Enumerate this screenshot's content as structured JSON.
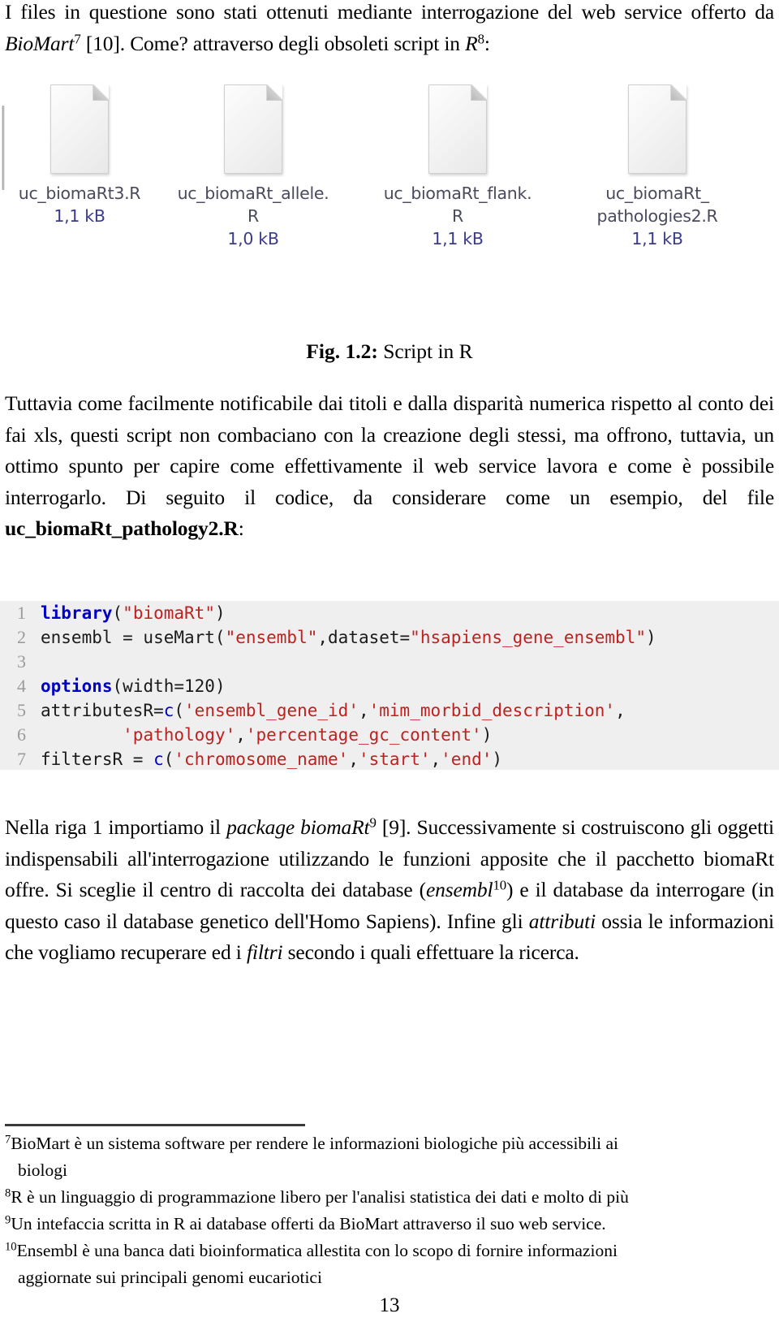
{
  "document": {
    "page_number": "13",
    "intro_paragraph": {
      "part1": "I files in questione sono stati ottenuti mediante interrogazione del web service offerto da ",
      "biomart_italic": "BioMart",
      "biomart_sup": "7",
      "part2": " [10]. Come? attraverso degli obsoleti script in ",
      "r_italic": "R",
      "r_sup": "8",
      "part3": ":"
    }
  },
  "figure": {
    "caption_label": "Fig. 1.2:",
    "caption_text": " Script in R",
    "files": [
      {
        "name": "uc_biomaRt3.R",
        "size": "1,1 kB",
        "icon": "file-document-icon"
      },
      {
        "name": "uc_biomaRt_allele.\nR",
        "size": "1,0 kB",
        "icon": "file-document-icon"
      },
      {
        "name": "uc_biomaRt_flank.\nR",
        "size": "1,1 kB",
        "icon": "file-document-icon"
      },
      {
        "name": "uc_biomaRt_\npathologies2.R",
        "size": "1,1 kB",
        "icon": "file-document-icon"
      }
    ]
  },
  "body": {
    "paragraph1": {
      "text_a": "Tuttavia come facilmente notificabile dai titoli e dalla disparità numerica rispetto al conto dei fai xls, questi script non combaciano con la creazione degli stessi, ma offrono, tuttavia, un ottimo spunto per capire come effettivamente il web service lavora e come è possibile interrogarlo. Di seguito il codice, da considerare come un esempio, del file ",
      "filename_bold": "uc_biomaRt_pathology2.R",
      "text_b": ":"
    },
    "paragraph2": {
      "text_a": "Nella riga 1 importiamo il ",
      "italic_a": "package biomaRt",
      "sup_a": "9",
      "text_b": " [9].  Successivamente si costruiscono gli oggetti indispensabili all'interrogazione utilizzando le funzioni apposite che il pacchetto biomaRt offre.  Si sceglie il centro di raccolta dei database (",
      "italic_b": "ensembl",
      "sup_b": "10",
      "text_c": ") e il database da interrogare (in questo caso il database genetico dell'Homo Sapiens).  Infine gli ",
      "italic_c": "attributi",
      "text_d": " ossia le informazioni che vogliamo recuperare ed i ",
      "italic_d": "filtri",
      "text_e": " secondo i quali effettuare la ricerca."
    }
  },
  "code_listing": {
    "background_color": "#efefef",
    "keyword_color": "#0000c8",
    "string_color": "#c02020",
    "linenum_color": "#9b9b9b",
    "lines": [
      {
        "num": "1",
        "segments": [
          {
            "t": "library",
            "c": "kw"
          },
          {
            "t": "(",
            "c": ""
          },
          {
            "t": "\"biomaRt\"",
            "c": "str"
          },
          {
            "t": ")",
            "c": ""
          }
        ]
      },
      {
        "num": "2",
        "segments": [
          {
            "t": "ensembl = useMart(",
            "c": ""
          },
          {
            "t": "\"ensembl\"",
            "c": "str"
          },
          {
            "t": ",dataset=",
            "c": ""
          },
          {
            "t": "\"hsapiens_gene_ensembl\"",
            "c": "str"
          },
          {
            "t": ")",
            "c": ""
          }
        ]
      },
      {
        "num": "3",
        "segments": [
          {
            "t": "",
            "c": ""
          }
        ]
      },
      {
        "num": "4",
        "segments": [
          {
            "t": "options",
            "c": "kw"
          },
          {
            "t": "(width=120)",
            "c": ""
          }
        ]
      },
      {
        "num": "5",
        "segments": [
          {
            "t": "attributesR=",
            "c": ""
          },
          {
            "t": "c",
            "c": "fn"
          },
          {
            "t": "(",
            "c": ""
          },
          {
            "t": "'ensembl_gene_id'",
            "c": "str"
          },
          {
            "t": ",",
            "c": ""
          },
          {
            "t": "'mim_morbid_description'",
            "c": "str"
          },
          {
            "t": ",",
            "c": ""
          }
        ]
      },
      {
        "num": "6",
        "segments": [
          {
            "t": "        ",
            "c": ""
          },
          {
            "t": "'pathology'",
            "c": "str"
          },
          {
            "t": ",",
            "c": ""
          },
          {
            "t": "'percentage_gc_content'",
            "c": "str"
          },
          {
            "t": ")",
            "c": ""
          }
        ]
      },
      {
        "num": "7",
        "segments": [
          {
            "t": "filtersR = ",
            "c": ""
          },
          {
            "t": "c",
            "c": "fn"
          },
          {
            "t": "(",
            "c": ""
          },
          {
            "t": "'chromosome_name'",
            "c": "str"
          },
          {
            "t": ",",
            "c": ""
          },
          {
            "t": "'start'",
            "c": "str"
          },
          {
            "t": ",",
            "c": ""
          },
          {
            "t": "'end'",
            "c": "str"
          },
          {
            "t": ")",
            "c": ""
          }
        ]
      }
    ]
  },
  "footnotes": [
    {
      "marker": "7",
      "line1": "BioMart è un sistema software per rendere le informazioni biologiche più accessibili ai",
      "line2": "biologi"
    },
    {
      "marker": "8",
      "line1": "R è un linguaggio di programmazione libero per l'analisi statistica dei dati e molto di più",
      "line2": ""
    },
    {
      "marker": "9",
      "line1": "Un intefaccia scritta in R ai database offerti da BioMart attraverso il suo web service.",
      "line2": ""
    },
    {
      "marker": "10",
      "line1": "Ensembl è una banca dati bioinformatica allestita con lo scopo di fornire informazioni",
      "line2": "aggiornate sui principali genomi eucariotici"
    }
  ]
}
